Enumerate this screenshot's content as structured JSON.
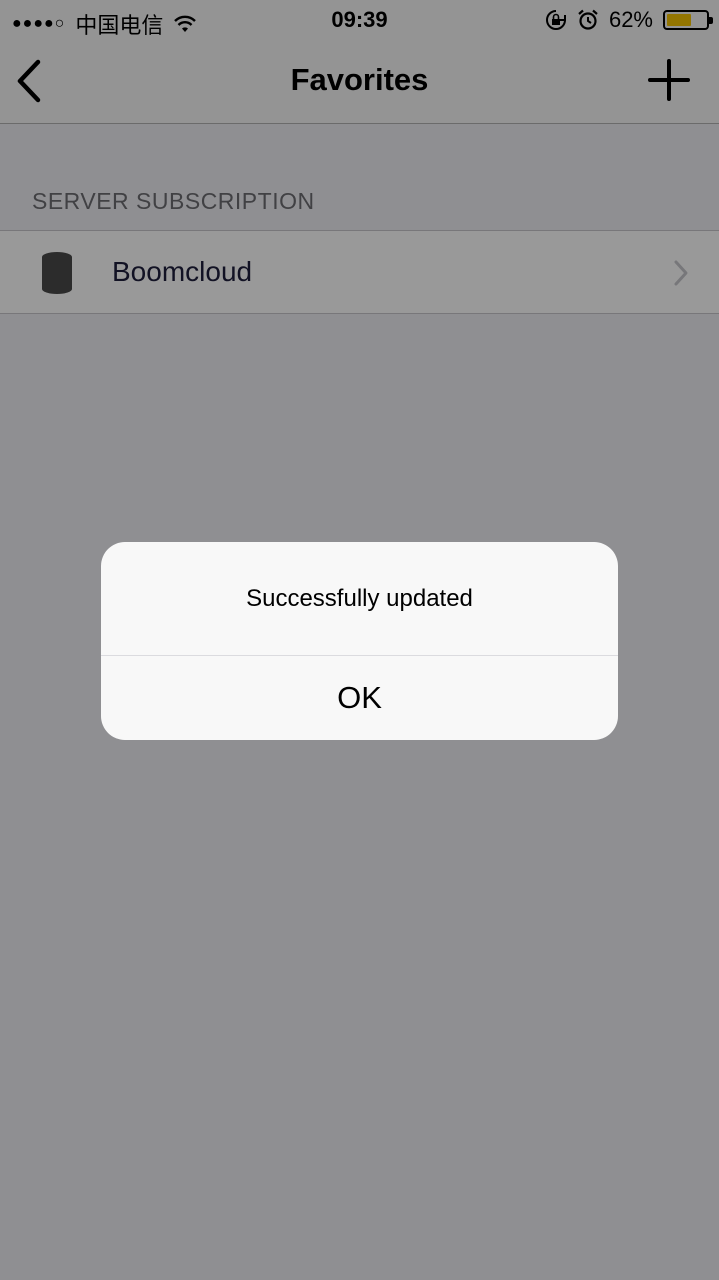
{
  "status_bar": {
    "signal": "●●●●○",
    "carrier": "中国电信",
    "time": "09:39",
    "battery_percent_label": "62%",
    "battery_level": 0.62,
    "battery_color": "#f5c400",
    "icons": [
      "wifi-icon",
      "lock-rotation-icon",
      "alarm-icon",
      "battery-icon"
    ]
  },
  "nav_bar": {
    "title": "Favorites",
    "back_icon": "chevron-left-icon",
    "add_icon": "plus-icon"
  },
  "section": {
    "header": "SERVER SUBSCRIPTION",
    "items": [
      {
        "label": "Boomcloud",
        "icon": "server-icon",
        "accessory": "chevron-right-icon"
      }
    ]
  },
  "alert": {
    "message": "Successfully updated",
    "ok_label": "OK"
  }
}
